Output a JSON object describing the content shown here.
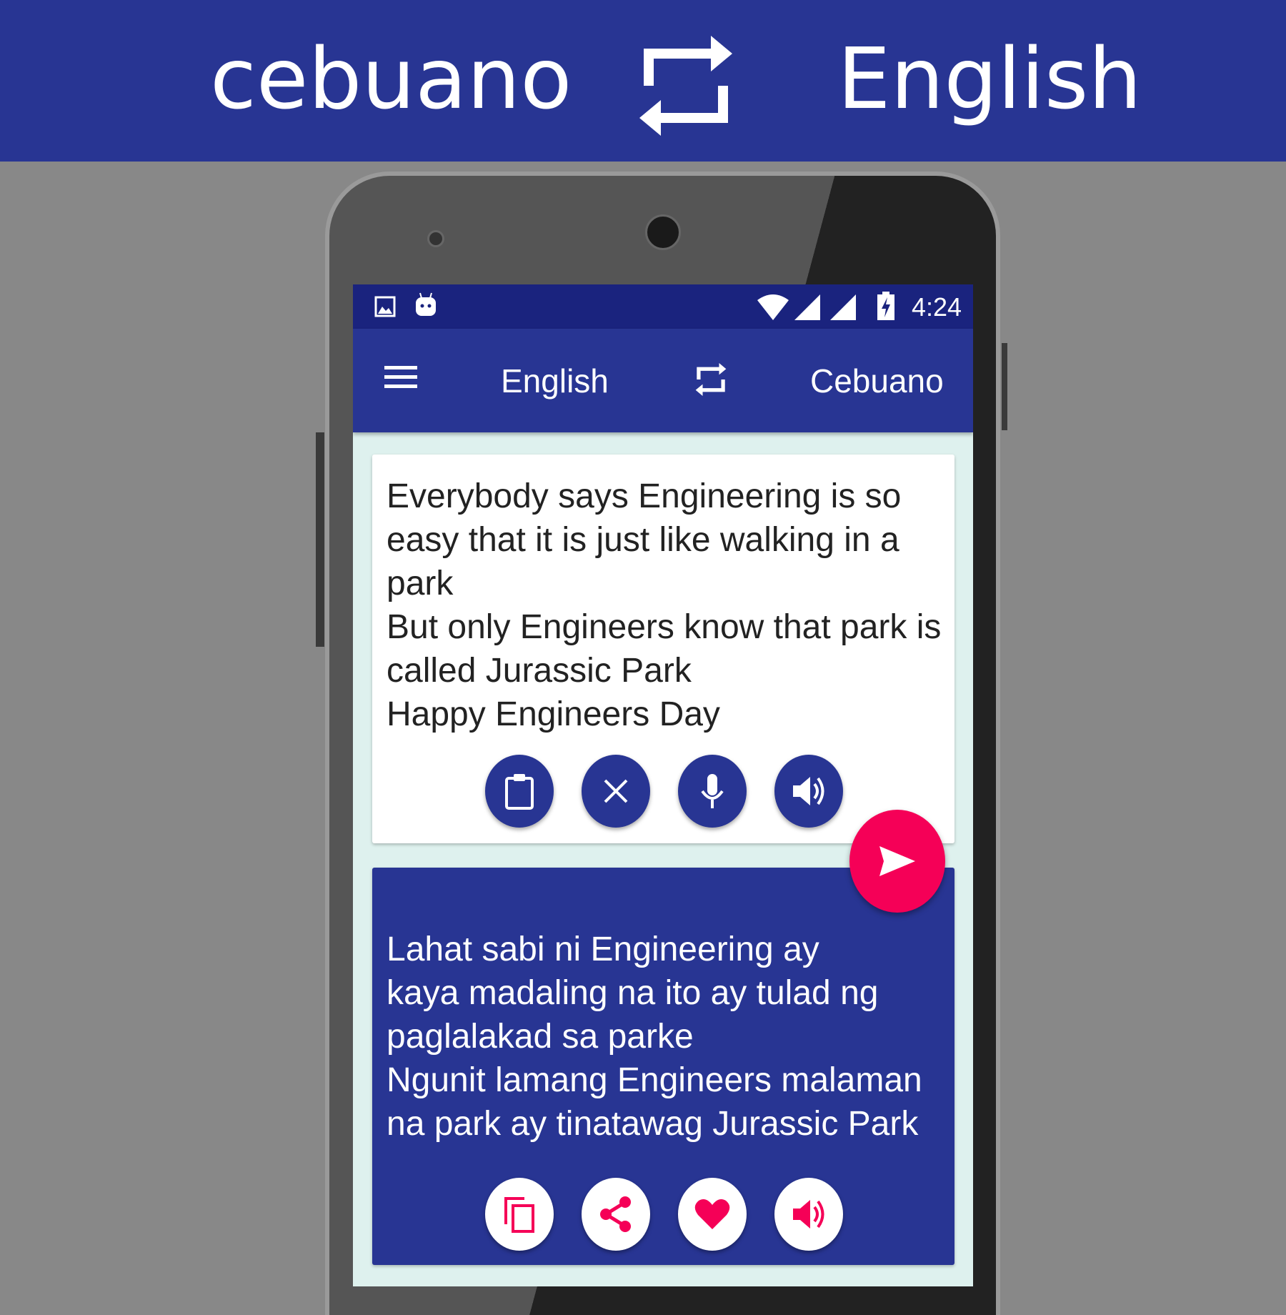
{
  "banner": {
    "from_language": "cebuano",
    "to_language": "English",
    "swap_icon": "swap-arrows-icon"
  },
  "status_bar": {
    "time": "4:24",
    "icons": [
      "image-icon",
      "android-icon",
      "wifi-icon",
      "signal-icon",
      "signal-icon",
      "battery-charging-icon"
    ]
  },
  "toolbar": {
    "menu_icon": "hamburger-menu-icon",
    "source_language": "English",
    "target_language": "Cebuano",
    "swap_icon": "swap-arrows-icon"
  },
  "input_card": {
    "text": "Everybody says Engineering is so\neasy that it is just like walking in a\npark\nBut only Engineers know that park is\ncalled Jurassic Park\nHappy Engineers Day",
    "buttons": [
      "paste-icon",
      "clear-icon",
      "microphone-icon",
      "speaker-icon"
    ]
  },
  "translate_button": {
    "icon": "send-icon"
  },
  "output_card": {
    "text": "Lahat sabi ni Engineering ay\nkaya madaling na ito ay tulad ng\npaglalakad sa parke\nNgunit lamang Engineers malaman\nna park ay tinatawag Jurassic Park",
    "buttons": [
      "copy-icon",
      "share-icon",
      "favorite-icon",
      "speaker-icon"
    ]
  },
  "colors": {
    "primary": "#283593",
    "primary_dark": "#1a237e",
    "accent": "#f50057",
    "background": "#def1ee"
  }
}
